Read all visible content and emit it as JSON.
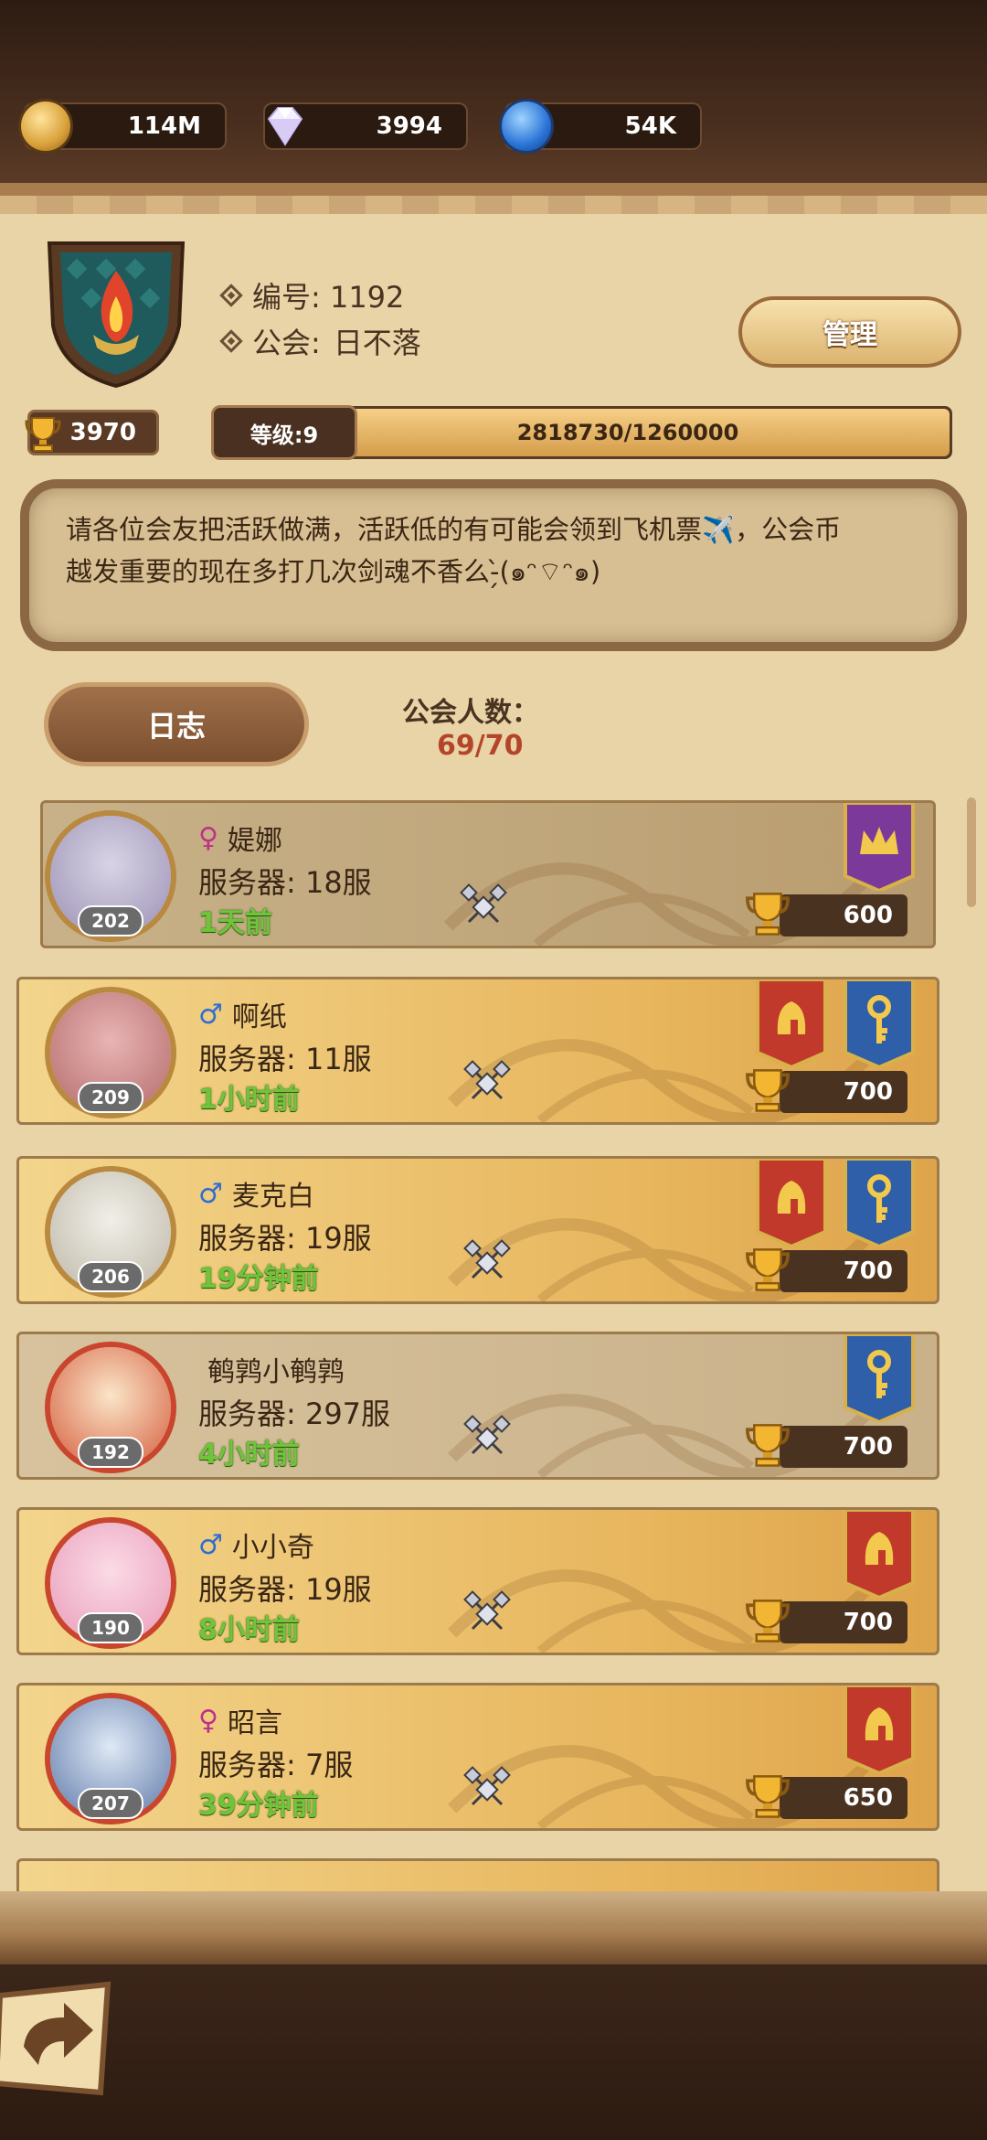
{
  "resources": {
    "gold": "114M",
    "diamonds": "3994",
    "essence": "54K"
  },
  "guild": {
    "id_label": "编号: 1192",
    "name_label": "公会:",
    "name": "日不落",
    "manage_label": "管理",
    "trophies": "3970",
    "level_label": "等级:9",
    "exp_text": "2818730/1260000",
    "exp_fraction": 1.0,
    "notice_line1": "请各位会友把活跃做满，活跃低的有可能会领到飞机票✈️，公会币",
    "notice_line2": "越发重要的现在多打几次剑魂不香么-̗̀(๑ᵔ⌔ᵔ๑)",
    "log_label": "日志",
    "member_count_label": "公会人数：",
    "member_count": "69/70"
  },
  "members": [
    {
      "sex": "♀",
      "sex_class": "f",
      "name": "媞娜",
      "server": "服务器: 18服",
      "last_seen": "1天前",
      "level": "202",
      "score": "600",
      "banners": [
        "purple-crown"
      ]
    },
    {
      "sex": "♂",
      "sex_class": "m",
      "name": "啊纸",
      "server": "服务器: 11服",
      "last_seen": "1小时前",
      "level": "209",
      "score": "700",
      "banners": [
        "red-helm",
        "blue-key"
      ]
    },
    {
      "sex": "♂",
      "sex_class": "m",
      "name": "麦克白",
      "server": "服务器: 19服",
      "last_seen": "19分钟前",
      "level": "206",
      "score": "700",
      "banners": [
        "red-helm",
        "blue-key"
      ]
    },
    {
      "sex": "",
      "sex_class": "",
      "name": "鹌鹑小鹌鹑",
      "server": "服务器: 297服",
      "last_seen": "4小时前",
      "level": "192",
      "score": "700",
      "banners": [
        "blue-key"
      ]
    },
    {
      "sex": "♂",
      "sex_class": "m",
      "name": "小小奇",
      "server": "服务器: 19服",
      "last_seen": "8小时前",
      "level": "190",
      "score": "700",
      "banners": [
        "red-helm"
      ]
    },
    {
      "sex": "♀",
      "sex_class": "f",
      "name": "昭言",
      "server": "服务器: 7服",
      "last_seen": "39分钟前",
      "level": "207",
      "score": "650",
      "banners": [
        "red-helm"
      ]
    }
  ],
  "colors": {
    "parchment": "#e8d4a6",
    "time_green": "#6fc43a",
    "count_red": "#b5452a",
    "female": "#c0308a",
    "male": "#2f6fd1"
  }
}
